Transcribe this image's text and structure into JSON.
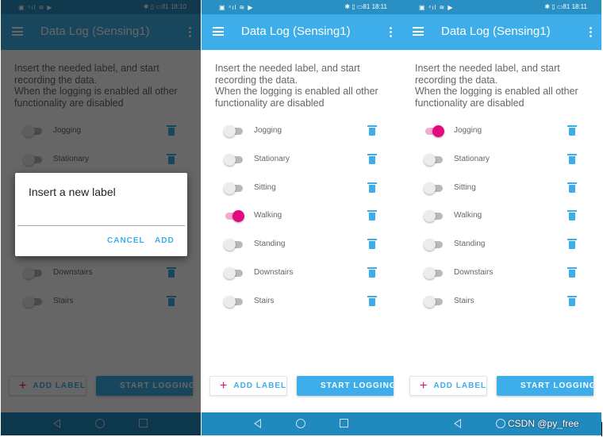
{
  "colors": {
    "primary": "#3daee9",
    "accent": "#e5097f",
    "status_bar": "#2a8fc2",
    "nav_bar": "#2089bd"
  },
  "phones": [
    {
      "time": "18:10",
      "battery": "81",
      "title": "Data Log (Sensing1)",
      "intro": "Insert the needed label, and start recording the data.\nWhen the logging is enabled all other functionality are disabled",
      "labels": [
        {
          "name": "Jogging",
          "on": false
        },
        {
          "name": "Stationary",
          "on": false
        },
        {
          "name": "",
          "on": false
        },
        {
          "name": "",
          "on": false
        },
        {
          "name": "",
          "on": false
        },
        {
          "name": "Downstairs",
          "on": false
        },
        {
          "name": "Stairs",
          "on": false
        }
      ],
      "add_label": "ADD LABEL",
      "start_logging": "START LOGGING",
      "dialog": {
        "title": "Insert a new label",
        "input_value": "",
        "cancel": "CANCEL",
        "add": "ADD"
      }
    },
    {
      "time": "18:11",
      "battery": "81",
      "title": "Data Log (Sensing1)",
      "intro": "Insert the needed label, and start recording the data.\nWhen the logging is enabled all other functionality are disabled",
      "labels": [
        {
          "name": "Jogging",
          "on": false
        },
        {
          "name": "Stationary",
          "on": false
        },
        {
          "name": "Sitting",
          "on": false
        },
        {
          "name": "Walking",
          "on": true
        },
        {
          "name": "Standing",
          "on": false
        },
        {
          "name": "Downstairs",
          "on": false
        },
        {
          "name": "Stairs",
          "on": false
        }
      ],
      "add_label": "ADD LABEL",
      "start_logging": "START LOGGING"
    },
    {
      "time": "18:11",
      "battery": "81",
      "title": "Data Log (Sensing1)",
      "intro": "Insert the needed label, and start recording the data.\nWhen the logging is enabled all other functionality are disabled",
      "labels": [
        {
          "name": "Jogging",
          "on": true
        },
        {
          "name": "Stationary",
          "on": false
        },
        {
          "name": "Sitting",
          "on": false
        },
        {
          "name": "Walking",
          "on": false
        },
        {
          "name": "Standing",
          "on": false
        },
        {
          "name": "Downstairs",
          "on": false
        },
        {
          "name": "Stairs",
          "on": false
        }
      ],
      "add_label": "ADD LABEL",
      "start_logging": "START LOGGING"
    }
  ],
  "watermark": "CSDN @py_free"
}
